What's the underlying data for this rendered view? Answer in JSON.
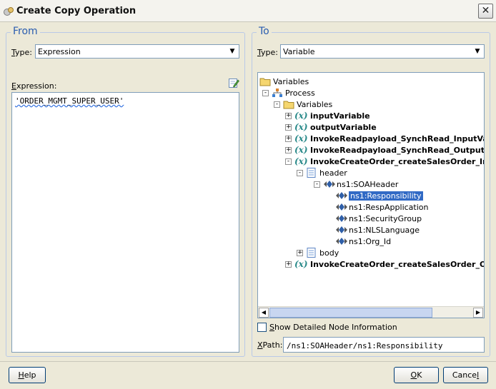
{
  "window": {
    "title": "Create Copy Operation",
    "close_symbol": "✕"
  },
  "from": {
    "legend": "From",
    "type_label": "ype:",
    "type_label_prefix": "T",
    "type_value": "Expression",
    "expression_label": "xpression:",
    "expression_label_prefix": "E",
    "expression_value": "'ORDER_MGMT_SUPER_USER'"
  },
  "to": {
    "legend": "To",
    "type_label": "ype:",
    "type_label_prefix": "T",
    "type_value": "Variable",
    "tree": [
      {
        "label": "Variables",
        "icon": "folder-icon",
        "expander": "",
        "bold": false,
        "selected": false,
        "level": 0
      },
      {
        "label": "Process",
        "icon": "process-icon",
        "expander": "-",
        "bold": false,
        "selected": false,
        "level": 1
      },
      {
        "label": "Variables",
        "icon": "folder-icon",
        "expander": "-",
        "bold": false,
        "selected": false,
        "level": 2
      },
      {
        "label": "inputVariable",
        "icon": "variable-icon",
        "expander": "+",
        "bold": true,
        "selected": false,
        "level": 3
      },
      {
        "label": "outputVariable",
        "icon": "variable-icon",
        "expander": "+",
        "bold": true,
        "selected": false,
        "level": 3
      },
      {
        "label": "InvokeReadpayload_SynchRead_InputVa",
        "icon": "variable-icon",
        "expander": "+",
        "bold": true,
        "selected": false,
        "level": 3
      },
      {
        "label": "InvokeReadpayload_SynchRead_OutputV",
        "icon": "variable-icon",
        "expander": "+",
        "bold": true,
        "selected": false,
        "level": 3
      },
      {
        "label": "InvokeCreateOrder_createSalesOrder_In",
        "icon": "variable-icon",
        "expander": "-",
        "bold": true,
        "selected": false,
        "level": 3
      },
      {
        "label": "header",
        "icon": "message-part-icon",
        "expander": "-",
        "bold": false,
        "selected": false,
        "level": 4
      },
      {
        "label": "ns1:SOAHeader",
        "icon": "element-icon",
        "expander": "-",
        "bold": false,
        "selected": false,
        "level": 5
      },
      {
        "label": "ns1:Responsibility",
        "icon": "element-icon",
        "expander": "",
        "bold": false,
        "selected": true,
        "level": 6
      },
      {
        "label": "ns1:RespApplication",
        "icon": "element-icon",
        "expander": "",
        "bold": false,
        "selected": false,
        "level": 6
      },
      {
        "label": "ns1:SecurityGroup",
        "icon": "element-icon",
        "expander": "",
        "bold": false,
        "selected": false,
        "level": 6
      },
      {
        "label": "ns1:NLSLanguage",
        "icon": "element-icon",
        "expander": "",
        "bold": false,
        "selected": false,
        "level": 6
      },
      {
        "label": "ns1:Org_Id",
        "icon": "element-icon",
        "expander": "",
        "bold": false,
        "selected": false,
        "level": 6
      },
      {
        "label": "body",
        "icon": "message-part-icon",
        "expander": "+",
        "bold": false,
        "selected": false,
        "level": 4
      },
      {
        "label": "InvokeCreateOrder_createSalesOrder_Ou",
        "icon": "variable-icon",
        "expander": "+",
        "bold": true,
        "selected": false,
        "level": 3
      }
    ],
    "show_detail_label": "how Detailed Node Information",
    "show_detail_prefix": "S",
    "show_detail_checked": false,
    "xpath_label": "Path:",
    "xpath_prefix": "X",
    "xpath_value": "/ns1:SOAHeader/ns1:Responsibility"
  },
  "buttons": {
    "help": "elp",
    "help_prefix": "H",
    "ok": "K",
    "ok_prefix": "O",
    "cancel_prefix": "Cance",
    "cancel_u": "l"
  },
  "colors": {
    "legend": "#2a5db0",
    "selection": "#316ac5",
    "dialog_bg": "#ece9d8"
  }
}
